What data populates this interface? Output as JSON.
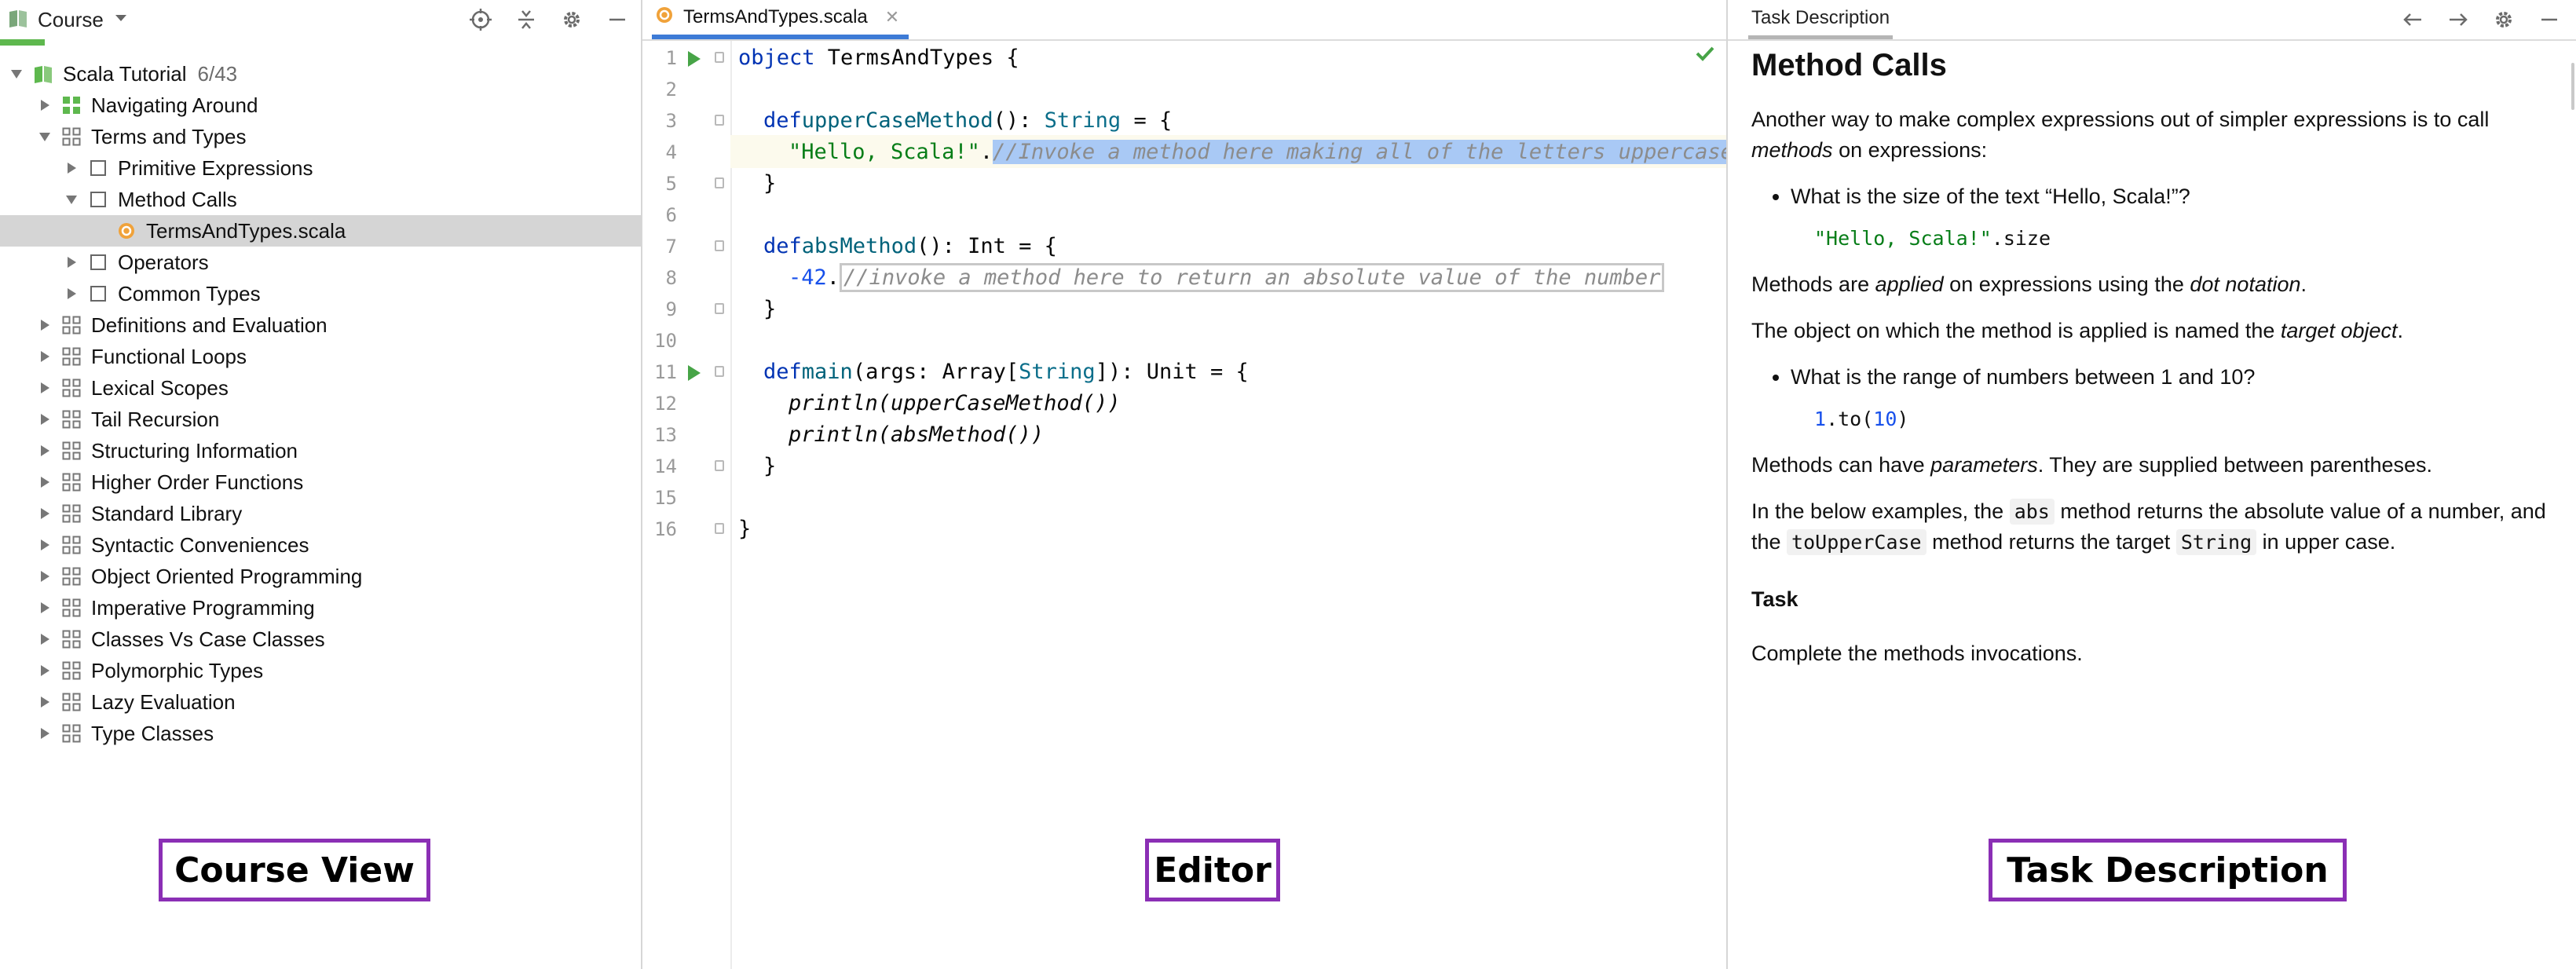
{
  "course_panel": {
    "title": "Course",
    "progress_fraction": 0.07,
    "root": {
      "label": "Scala Tutorial",
      "count": "6/43"
    },
    "items": [
      {
        "label": "Navigating Around",
        "depth": 1,
        "expanded": false,
        "icon": "lesson-solved-icon"
      },
      {
        "label": "Terms and Types",
        "depth": 1,
        "expanded": true,
        "icon": "lesson-icon"
      },
      {
        "label": "Primitive Expressions",
        "depth": 2,
        "expanded": false,
        "icon": "task-icon"
      },
      {
        "label": "Method Calls",
        "depth": 2,
        "expanded": true,
        "icon": "task-icon"
      },
      {
        "label": "TermsAndTypes.scala",
        "depth": 3,
        "file": true,
        "selected": true,
        "icon": "scala-file-icon"
      },
      {
        "label": "Operators",
        "depth": 2,
        "expanded": false,
        "icon": "task-icon"
      },
      {
        "label": "Common Types",
        "depth": 2,
        "expanded": false,
        "icon": "task-icon"
      },
      {
        "label": "Definitions and Evaluation",
        "depth": 1,
        "expanded": false,
        "icon": "lesson-icon"
      },
      {
        "label": "Functional Loops",
        "depth": 1,
        "expanded": false,
        "icon": "lesson-icon"
      },
      {
        "label": "Lexical Scopes",
        "depth": 1,
        "expanded": false,
        "icon": "lesson-icon"
      },
      {
        "label": "Tail Recursion",
        "depth": 1,
        "expanded": false,
        "icon": "lesson-icon"
      },
      {
        "label": "Structuring Information",
        "depth": 1,
        "expanded": false,
        "icon": "lesson-icon"
      },
      {
        "label": "Higher Order Functions",
        "depth": 1,
        "expanded": false,
        "icon": "lesson-icon"
      },
      {
        "label": "Standard Library",
        "depth": 1,
        "expanded": false,
        "icon": "lesson-icon"
      },
      {
        "label": "Syntactic Conveniences",
        "depth": 1,
        "expanded": false,
        "icon": "lesson-icon"
      },
      {
        "label": "Object Oriented Programming",
        "depth": 1,
        "expanded": false,
        "icon": "lesson-icon"
      },
      {
        "label": "Imperative Programming",
        "depth": 1,
        "expanded": false,
        "icon": "lesson-icon"
      },
      {
        "label": "Classes Vs Case Classes",
        "depth": 1,
        "expanded": false,
        "icon": "lesson-icon"
      },
      {
        "label": "Polymorphic Types",
        "depth": 1,
        "expanded": false,
        "icon": "lesson-icon"
      },
      {
        "label": "Lazy Evaluation",
        "depth": 1,
        "expanded": false,
        "icon": "lesson-icon"
      },
      {
        "label": "Type Classes",
        "depth": 1,
        "expanded": false,
        "icon": "lesson-icon"
      }
    ]
  },
  "editor": {
    "tab_label": "TermsAndTypes.scala",
    "line_numbers": [
      "1",
      "2",
      "3",
      "4",
      "5",
      "6",
      "7",
      "8",
      "9",
      "10",
      "11",
      "12",
      "13",
      "14",
      "15",
      "16"
    ],
    "code": {
      "l1_kw": "object",
      "l1_rest": " TermsAndTypes {",
      "l3_kw": "def",
      "l3_name": "upperCaseMethod",
      "l3_mid": "(): ",
      "l3_type": "String",
      "l3_end": " = {",
      "l4_str": "\"Hello, Scala!\"",
      "l4_dot": ".",
      "l4_placeholder": "//Invoke a method here making all of the letters uppercase",
      "l5": "}",
      "l7_kw": "def",
      "l7_name": "absMethod",
      "l7_rest": "(): Int = {",
      "l8_num": "-42",
      "l8_dot": ".",
      "l8_placeholder": "//invoke a method here to return an absolute value of the number",
      "l9": "}",
      "l11_kw": "def",
      "l11_name": "main",
      "l11_mid": "(args: Array[",
      "l11_type": "String",
      "l11_end": "]): Unit = {",
      "l12_fn": "println",
      "l12_arg": "(upperCaseMethod())",
      "l13_fn": "println",
      "l13_arg": "(absMethod())",
      "l14": "}",
      "l16": "}"
    }
  },
  "task": {
    "tab_label": "Task Description",
    "heading": "Method Calls",
    "p1_a": "Another way to make complex expressions out of simpler expressions is to call ",
    "p1_em": "methods",
    "p1_b": " on expressions:",
    "bullet1": "What is the size of the text “Hello, Scala!”?",
    "code1_str": "\"Hello, Scala!\"",
    "code1_rest": ".size",
    "p2_a": "Methods are ",
    "p2_em1": "applied",
    "p2_b": " on expressions using the ",
    "p2_em2": "dot notation",
    "p2_c": ".",
    "p3_a": "The object on which the method is applied is named the ",
    "p3_em": "target object",
    "p3_b": ".",
    "bullet2": "What is the range of numbers between 1 and 10?",
    "code2_n1": "1",
    "code2_mid": ".to(",
    "code2_n2": "10",
    "code2_end": ")",
    "p4_a": "Methods can have ",
    "p4_em": "parameters",
    "p4_b": ". They are supplied between parentheses.",
    "p5_a": "In the below examples, the ",
    "p5_code1": "abs",
    "p5_b": " method returns the absolute value of a number, and the ",
    "p5_code2": "toUpperCase",
    "p5_c": " method returns the target ",
    "p5_code3": "String",
    "p5_d": " in upper case.",
    "task_title": "Task",
    "p6": "Complete the methods invocations."
  },
  "annotations": {
    "course": "Course View",
    "editor": "Editor",
    "task": "Task Description"
  },
  "colors": {
    "progress": "#5eb84e",
    "tab_underline": "#3d7bd6",
    "annotation_border": "#8b2fb5",
    "selection": "#a9c9f5"
  }
}
